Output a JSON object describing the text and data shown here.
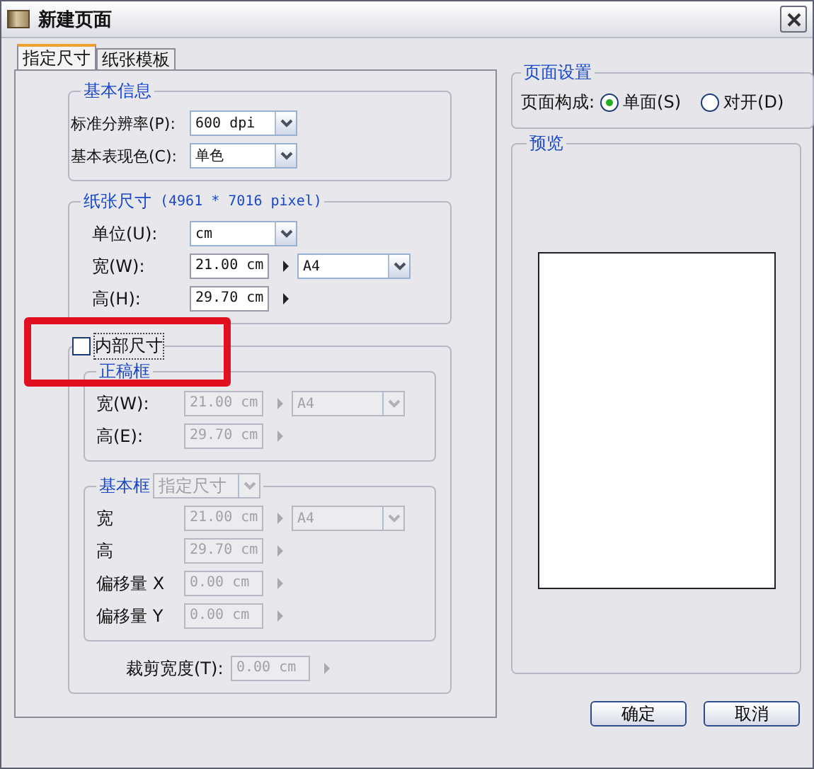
{
  "window": {
    "title": "新建页面"
  },
  "tabs": [
    {
      "label": "指定尺寸",
      "selected": true
    },
    {
      "label": "纸张模板",
      "selected": false
    }
  ],
  "basic_info": {
    "title": "基本信息",
    "rows": [
      {
        "kind": "select",
        "label": "标准分辨率(P):",
        "value": "600 dpi"
      },
      {
        "kind": "select",
        "label": "基本表现色(C):",
        "value": "单色"
      }
    ]
  },
  "paper_size": {
    "title": "纸张尺寸",
    "note": "(4961 * 7016 pixel)",
    "rows": [
      {
        "kind": "select",
        "label": "单位(U):",
        "value": "cm"
      },
      {
        "kind": "field",
        "label": "宽(W):",
        "value": "21.00 cm",
        "preset": "A4"
      },
      {
        "kind": "field",
        "label": "高(H):",
        "value": "29.70 cm"
      }
    ]
  },
  "inner_size": {
    "label": "内部尺寸",
    "checked": false,
    "finish_frame": {
      "title": "正稿框",
      "rows": [
        {
          "kind": "field",
          "label": "宽(W):",
          "value": "21.00 cm",
          "preset": "A4"
        },
        {
          "kind": "field",
          "label": "高(E):",
          "value": "29.70 cm"
        }
      ]
    },
    "base_frame": {
      "title": "基本框",
      "mode": "指定尺寸",
      "rows": [
        {
          "kind": "field",
          "label": "宽",
          "value": "21.00 cm",
          "preset": "A4"
        },
        {
          "kind": "field",
          "label": "高",
          "value": "29.70 cm"
        },
        {
          "kind": "field",
          "label": "偏移量 X",
          "value": "0.00 cm"
        },
        {
          "kind": "field",
          "label": "偏移量 Y",
          "value": "0.00 cm"
        }
      ]
    },
    "crop": {
      "kind": "field",
      "label": "裁剪宽度(T):",
      "value": "0.00 cm"
    }
  },
  "page_setup": {
    "title": "页面设置",
    "label": "页面构成:",
    "options": [
      {
        "label": "单面(S)",
        "selected": true
      },
      {
        "label": "对开(D)",
        "selected": false
      }
    ]
  },
  "preview": {
    "title": "预览"
  },
  "buttons": [
    "确定",
    "取消"
  ]
}
